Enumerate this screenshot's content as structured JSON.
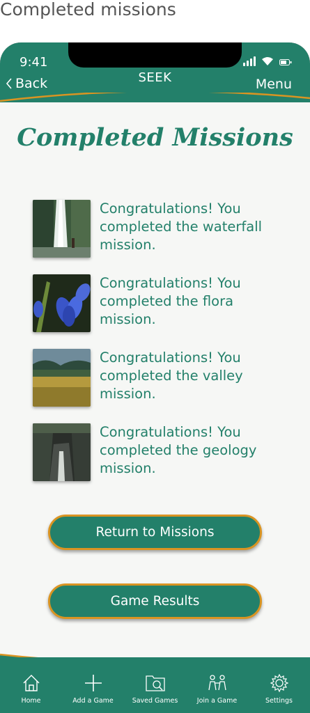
{
  "caption": "Completed missions",
  "status_bar": {
    "time": "9:41"
  },
  "nav": {
    "back_label": "Back",
    "title": "SEEK",
    "menu_label": "Menu"
  },
  "page_title": "Completed Missions",
  "missions": [
    {
      "text": "Congratulations! You completed the waterfall mission.",
      "image": "waterfall-photo"
    },
    {
      "text": "Congratulations! You completed the flora mission.",
      "image": "flora-photo"
    },
    {
      "text": "Congratulations! You completed the valley mission.",
      "image": "valley-photo"
    },
    {
      "text": "Congratulations! You completed the geology mission.",
      "image": "geology-photo"
    }
  ],
  "buttons": {
    "return_label": "Return to Missions",
    "results_label": "Game Results"
  },
  "tabs": [
    {
      "label": "Home",
      "icon": "home-icon"
    },
    {
      "label": "Add a Game",
      "icon": "plus-icon"
    },
    {
      "label": "Saved Games",
      "icon": "folder-search-icon"
    },
    {
      "label": "Join a Game",
      "icon": "people-icon"
    },
    {
      "label": "Settings",
      "icon": "gear-icon"
    }
  ],
  "colors": {
    "primary": "#23806a",
    "accent": "#d99422",
    "background": "#f6f7f5"
  }
}
